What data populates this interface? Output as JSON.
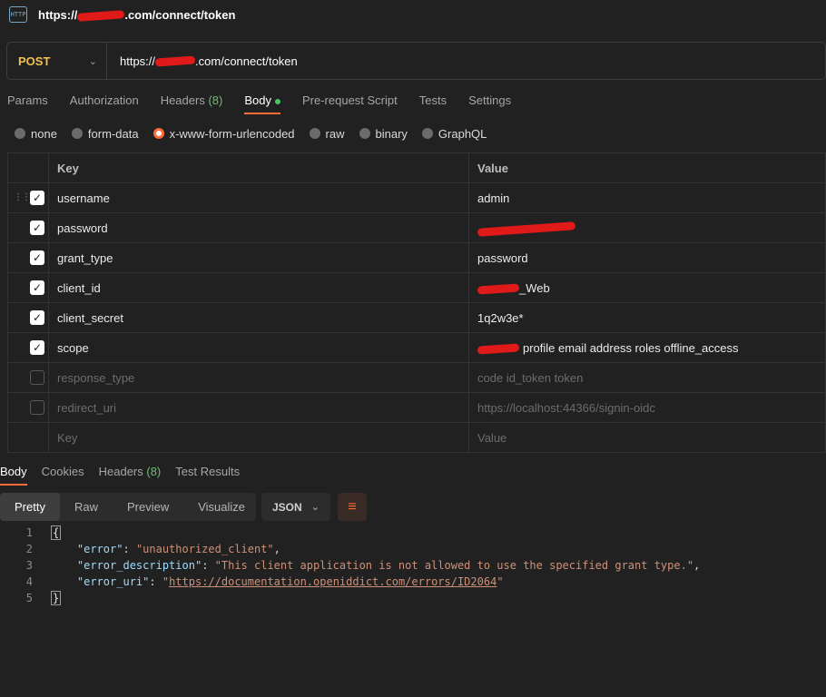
{
  "title": {
    "prefix": "https://",
    "suffix": ".com/connect/token"
  },
  "request": {
    "method": "POST",
    "url_prefix": "https://",
    "url_suffix": ".com/connect/token"
  },
  "request_tabs": [
    {
      "label": "Params"
    },
    {
      "label": "Authorization"
    },
    {
      "label": "Headers",
      "count": "(8)"
    },
    {
      "label": "Body"
    },
    {
      "label": "Pre-request Script"
    },
    {
      "label": "Tests"
    },
    {
      "label": "Settings"
    }
  ],
  "body_types": [
    "none",
    "form-data",
    "x-www-form-urlencoded",
    "raw",
    "binary",
    "GraphQL"
  ],
  "selected_body_type": "x-www-form-urlencoded",
  "table": {
    "key_header": "Key",
    "value_header": "Value",
    "rows": [
      {
        "key": "username",
        "value": "admin",
        "checked": true
      },
      {
        "key": "password",
        "value": "",
        "checked": true
      },
      {
        "key": "grant_type",
        "value": "password",
        "checked": true
      },
      {
        "key": "client_id",
        "value": "_Web",
        "checked": true
      },
      {
        "key": "client_secret",
        "value": "1q2w3e*",
        "checked": true
      },
      {
        "key": "scope",
        "value": "profile email address roles offline_access",
        "checked": true
      },
      {
        "key": "response_type",
        "value": "code id_token token",
        "checked": false
      },
      {
        "key": "redirect_uri",
        "value": "https://localhost:44366/signin-oidc",
        "checked": false
      }
    ],
    "placeholder_key": "Key",
    "placeholder_value": "Value"
  },
  "response_tabs": [
    {
      "label": "Body"
    },
    {
      "label": "Cookies"
    },
    {
      "label": "Headers",
      "count": "(8)"
    },
    {
      "label": "Test Results"
    }
  ],
  "view_modes": [
    "Pretty",
    "Raw",
    "Preview",
    "Visualize"
  ],
  "format": "JSON",
  "response": {
    "line_numbers": [
      "1",
      "2",
      "3",
      "4",
      "5"
    ],
    "open_brace": "{",
    "close_brace": "}",
    "error_key": "\"error\"",
    "error_value": "\"unauthorized_client\"",
    "desc_key": "\"error_description\"",
    "desc_value": "\"This client application is not allowed to use the specified grant type.\"",
    "uri_key": "\"error_uri\"",
    "uri_value": "https://documentation.openiddict.com/errors/ID2064"
  },
  "colors": {
    "accent": "#ff6c37",
    "method": "#f2c14e",
    "json_key": "#9cdcfe",
    "json_string": "#ce9178"
  }
}
